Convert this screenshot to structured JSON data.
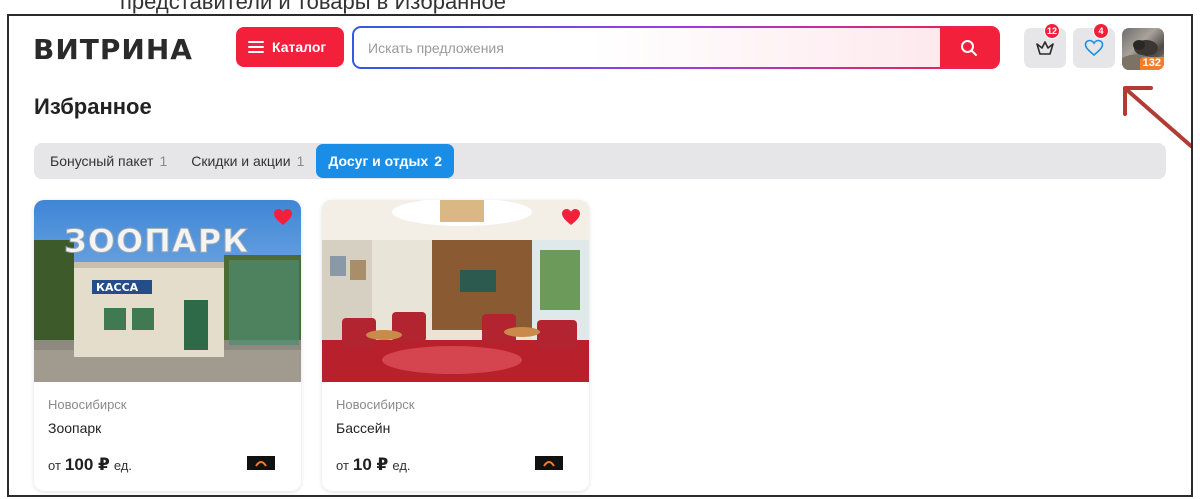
{
  "caption": "представители и товары в Избранное",
  "header": {
    "logo": "ВИТРИНА",
    "catalog_label": "Каталог",
    "search_placeholder": "Искать предложения",
    "cart_badge": "12",
    "favorites_badge": "4",
    "avatar_badge": "132"
  },
  "page": {
    "title": "Избранное"
  },
  "tabs": [
    {
      "label": "Бонусный пакет",
      "count": "1",
      "active": false
    },
    {
      "label": "Скидки и акции",
      "count": "1",
      "active": false
    },
    {
      "label": "Досуг и отдых",
      "count": "2",
      "active": true
    }
  ],
  "cards": [
    {
      "city": "Новосибирск",
      "name": "Зоопарк",
      "price_prefix": "от",
      "price_amount": "100 ₽",
      "price_unit": "ед.",
      "image_sign": "ЗООПАРК",
      "image_sub": "КАССА"
    },
    {
      "city": "Новосибирск",
      "name": "Бассейн",
      "price_prefix": "от",
      "price_amount": "10 ₽",
      "price_unit": "ед."
    }
  ],
  "colors": {
    "accent_red": "#f3203c",
    "accent_blue": "#1a8ee6",
    "annotation_arrow": "#b23b35"
  }
}
